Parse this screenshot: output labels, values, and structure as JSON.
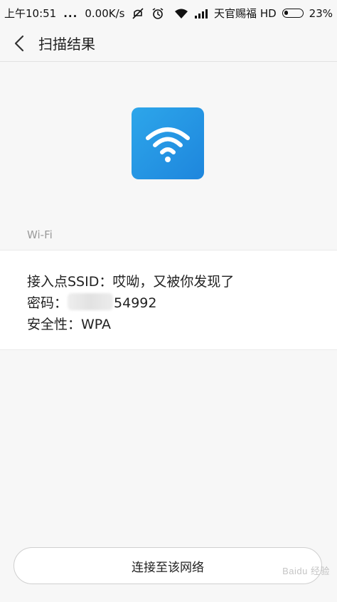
{
  "status_bar": {
    "time": "上午10:51",
    "dots": "...",
    "speed": "0.00K/s",
    "carrier": "天官赐福 HD",
    "battery_percent": "23%",
    "battery_level": 0.23
  },
  "header": {
    "title": "扫描结果"
  },
  "hero": {
    "icon": "wifi-icon",
    "icon_color": "#2196e3",
    "section_label": "Wi-Fi"
  },
  "result": {
    "ssid_line": "接入点SSID：哎呦，又被你发现了",
    "password_label": "密码：",
    "password_visible": "54992",
    "security_line": "安全性：WPA"
  },
  "footer": {
    "connect_label": "连接至该网络",
    "watermark": "Baidu 经验"
  }
}
